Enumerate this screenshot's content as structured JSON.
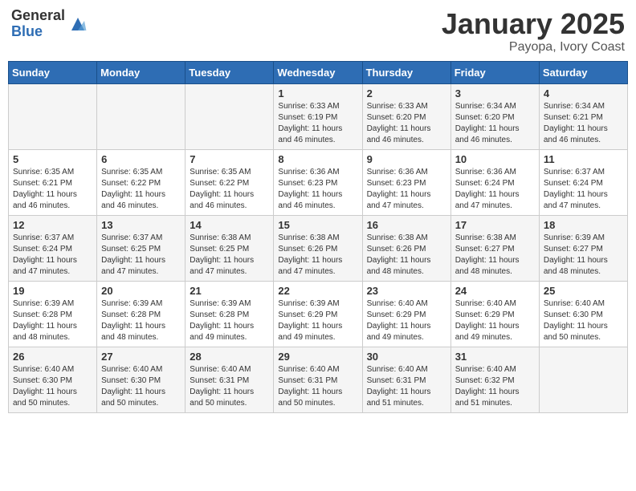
{
  "header": {
    "logo_general": "General",
    "logo_blue": "Blue",
    "month": "January 2025",
    "location": "Payopa, Ivory Coast"
  },
  "days_of_week": [
    "Sunday",
    "Monday",
    "Tuesday",
    "Wednesday",
    "Thursday",
    "Friday",
    "Saturday"
  ],
  "weeks": [
    [
      {
        "day": "",
        "info": ""
      },
      {
        "day": "",
        "info": ""
      },
      {
        "day": "",
        "info": ""
      },
      {
        "day": "1",
        "info": "Sunrise: 6:33 AM\nSunset: 6:19 PM\nDaylight: 11 hours and 46 minutes."
      },
      {
        "day": "2",
        "info": "Sunrise: 6:33 AM\nSunset: 6:20 PM\nDaylight: 11 hours and 46 minutes."
      },
      {
        "day": "3",
        "info": "Sunrise: 6:34 AM\nSunset: 6:20 PM\nDaylight: 11 hours and 46 minutes."
      },
      {
        "day": "4",
        "info": "Sunrise: 6:34 AM\nSunset: 6:21 PM\nDaylight: 11 hours and 46 minutes."
      }
    ],
    [
      {
        "day": "5",
        "info": "Sunrise: 6:35 AM\nSunset: 6:21 PM\nDaylight: 11 hours and 46 minutes."
      },
      {
        "day": "6",
        "info": "Sunrise: 6:35 AM\nSunset: 6:22 PM\nDaylight: 11 hours and 46 minutes."
      },
      {
        "day": "7",
        "info": "Sunrise: 6:35 AM\nSunset: 6:22 PM\nDaylight: 11 hours and 46 minutes."
      },
      {
        "day": "8",
        "info": "Sunrise: 6:36 AM\nSunset: 6:23 PM\nDaylight: 11 hours and 46 minutes."
      },
      {
        "day": "9",
        "info": "Sunrise: 6:36 AM\nSunset: 6:23 PM\nDaylight: 11 hours and 47 minutes."
      },
      {
        "day": "10",
        "info": "Sunrise: 6:36 AM\nSunset: 6:24 PM\nDaylight: 11 hours and 47 minutes."
      },
      {
        "day": "11",
        "info": "Sunrise: 6:37 AM\nSunset: 6:24 PM\nDaylight: 11 hours and 47 minutes."
      }
    ],
    [
      {
        "day": "12",
        "info": "Sunrise: 6:37 AM\nSunset: 6:24 PM\nDaylight: 11 hours and 47 minutes."
      },
      {
        "day": "13",
        "info": "Sunrise: 6:37 AM\nSunset: 6:25 PM\nDaylight: 11 hours and 47 minutes."
      },
      {
        "day": "14",
        "info": "Sunrise: 6:38 AM\nSunset: 6:25 PM\nDaylight: 11 hours and 47 minutes."
      },
      {
        "day": "15",
        "info": "Sunrise: 6:38 AM\nSunset: 6:26 PM\nDaylight: 11 hours and 47 minutes."
      },
      {
        "day": "16",
        "info": "Sunrise: 6:38 AM\nSunset: 6:26 PM\nDaylight: 11 hours and 48 minutes."
      },
      {
        "day": "17",
        "info": "Sunrise: 6:38 AM\nSunset: 6:27 PM\nDaylight: 11 hours and 48 minutes."
      },
      {
        "day": "18",
        "info": "Sunrise: 6:39 AM\nSunset: 6:27 PM\nDaylight: 11 hours and 48 minutes."
      }
    ],
    [
      {
        "day": "19",
        "info": "Sunrise: 6:39 AM\nSunset: 6:28 PM\nDaylight: 11 hours and 48 minutes."
      },
      {
        "day": "20",
        "info": "Sunrise: 6:39 AM\nSunset: 6:28 PM\nDaylight: 11 hours and 48 minutes."
      },
      {
        "day": "21",
        "info": "Sunrise: 6:39 AM\nSunset: 6:28 PM\nDaylight: 11 hours and 49 minutes."
      },
      {
        "day": "22",
        "info": "Sunrise: 6:39 AM\nSunset: 6:29 PM\nDaylight: 11 hours and 49 minutes."
      },
      {
        "day": "23",
        "info": "Sunrise: 6:40 AM\nSunset: 6:29 PM\nDaylight: 11 hours and 49 minutes."
      },
      {
        "day": "24",
        "info": "Sunrise: 6:40 AM\nSunset: 6:29 PM\nDaylight: 11 hours and 49 minutes."
      },
      {
        "day": "25",
        "info": "Sunrise: 6:40 AM\nSunset: 6:30 PM\nDaylight: 11 hours and 50 minutes."
      }
    ],
    [
      {
        "day": "26",
        "info": "Sunrise: 6:40 AM\nSunset: 6:30 PM\nDaylight: 11 hours and 50 minutes."
      },
      {
        "day": "27",
        "info": "Sunrise: 6:40 AM\nSunset: 6:30 PM\nDaylight: 11 hours and 50 minutes."
      },
      {
        "day": "28",
        "info": "Sunrise: 6:40 AM\nSunset: 6:31 PM\nDaylight: 11 hours and 50 minutes."
      },
      {
        "day": "29",
        "info": "Sunrise: 6:40 AM\nSunset: 6:31 PM\nDaylight: 11 hours and 50 minutes."
      },
      {
        "day": "30",
        "info": "Sunrise: 6:40 AM\nSunset: 6:31 PM\nDaylight: 11 hours and 51 minutes."
      },
      {
        "day": "31",
        "info": "Sunrise: 6:40 AM\nSunset: 6:32 PM\nDaylight: 11 hours and 51 minutes."
      },
      {
        "day": "",
        "info": ""
      }
    ]
  ]
}
